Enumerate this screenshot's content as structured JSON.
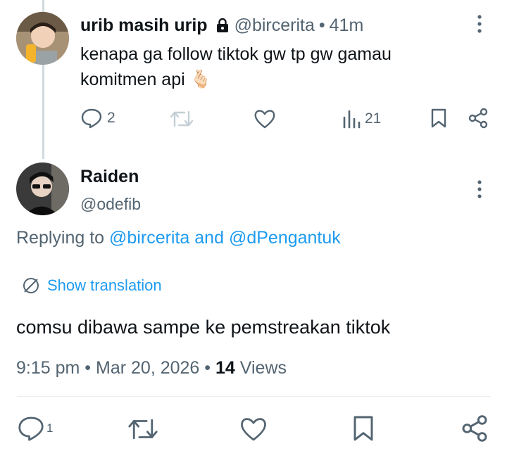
{
  "parent_tweet": {
    "display_name": "urib masih urip",
    "handle": "@bircerita",
    "separator": "•",
    "time": "41m",
    "text_line1": "kenapa ga follow tiktok gw tp gw gamau",
    "text_line2": "komitmen api",
    "emoji": "🫰🏻",
    "reply_count": "2",
    "views": "21",
    "avatar_icon": "user-avatar-photo",
    "locked_icon": "lock-icon"
  },
  "main_tweet": {
    "display_name": "Raiden",
    "handle": "@odefib",
    "replying_prefix": "Replying to",
    "reply_user1": "@bircerita",
    "reply_and": "and",
    "reply_user2": "@dPengantuk",
    "translate_label": "Show translation",
    "text": "comsu dibawa sampe ke pemstreakan tiktok",
    "time": "9:15 pm",
    "date": "Mar 20, 2026",
    "separator": "•",
    "views_count": "14",
    "views_label": "Views",
    "reply_count": "1"
  },
  "colors": {
    "text": "#0f1419",
    "muted": "#536471",
    "link": "#1d9bf0",
    "thread_line": "#cfd9de"
  }
}
